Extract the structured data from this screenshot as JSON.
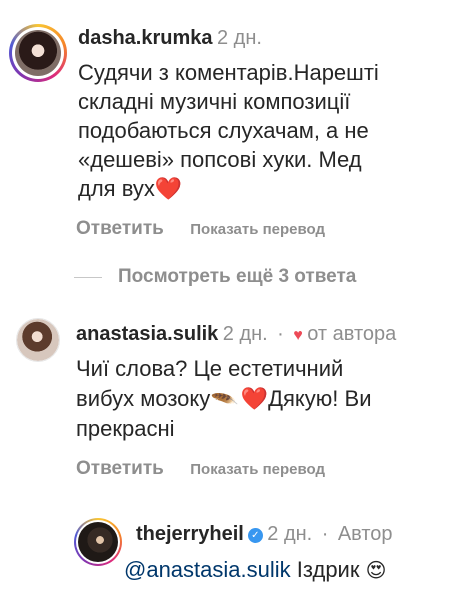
{
  "comment1": {
    "username": "dasha.krumka",
    "time": "2 дн.",
    "lines": [
      "Судячи з коментарів.Нарешті",
      "складні музичні композиції",
      "подобаються слухачам, а не",
      "«дешеві» попсові хуки. Мед",
      "для вух"
    ],
    "reply_label": "Ответить",
    "translate_label": "Показать перевод",
    "more_replies": "Посмотреть ещё 3 ответа"
  },
  "comment2": {
    "username": "anastasia.sulik",
    "time": "2 дн.",
    "dot": "·",
    "author_badge": "от автора",
    "line1": "Чиї слова? Це естетичний",
    "line2_a": "вибух мозоку",
    "line2_b": "Дякую! Ви",
    "line3": "прекрасні",
    "reply_label": "Ответить",
    "translate_label": "Показать перевод"
  },
  "comment3": {
    "username": "thejerryheil",
    "time": "2 дн.",
    "dot": "·",
    "author_label": "Автор",
    "mention": "@anastasia.sulik",
    "text": "Іздрик"
  },
  "icons": {
    "heart": "red-heart",
    "feather": "feather",
    "verified": "verified-badge",
    "emoji": "heart-eyes-emoji"
  },
  "colors": {
    "text": "#262626",
    "muted": "#8e8e8e",
    "red": "#ed4956",
    "link": "#00376b",
    "verified": "#3897f0"
  }
}
